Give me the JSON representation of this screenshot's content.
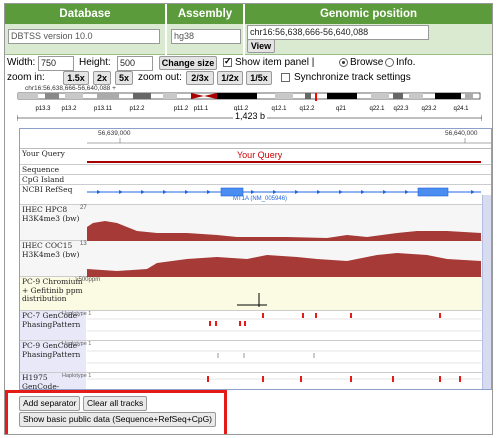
{
  "header": {
    "database_title": "Database",
    "assembly_title": "Assembly",
    "position_title": "Genomic position",
    "database_value": "DBTSS version 10.0",
    "assembly_value": "hg38",
    "position_value": "chr16:56,638,666-56,640,088",
    "view_label": "View"
  },
  "controls": {
    "width_label": "Width:",
    "width_value": "750",
    "height_label": "Height:",
    "height_value": "500",
    "change_size_label": "Change size",
    "show_item_panel_label": "Show item panel |",
    "browse_label": "Browse",
    "info_label": "Info.",
    "zoom_in_label": "zoom in:",
    "zoom_in_options": [
      "1.5x",
      "2x",
      "5x"
    ],
    "zoom_out_label": "zoom out:",
    "zoom_out_options": [
      "2/3x",
      "1/2x",
      "1/5x"
    ],
    "sync_label": "Synchronize track settings"
  },
  "ideogram": {
    "locus_text": "chr16:56,638,666-56,640,088 +",
    "bands": [
      "p13.3",
      "p13.2",
      "p13.11",
      "p12.2",
      "p11.2",
      "p11.1",
      "q11.2",
      "q12.1",
      "q12.2",
      "q21",
      "q22.1",
      "q22.3",
      "q23.2",
      "q24.1"
    ],
    "scale_text": "1,423 b"
  },
  "ruler": {
    "left_tick": "56,639,000",
    "right_tick": "56,640,000"
  },
  "tracks": [
    {
      "label": "Your Query",
      "center_text": "Your Query"
    },
    {
      "label": "Sequence"
    },
    {
      "label": "CpG Island"
    },
    {
      "label": "NCBI RefSeq",
      "gene_label": "MT1A (NM_005946)"
    },
    {
      "label": "IHEC HPC8 H3K4me3 (bw)",
      "scale": "27"
    },
    {
      "label": "IHEC COC15 H3K4me3 (bw)",
      "scale": "13"
    },
    {
      "label": "PC-9 Chromium + Gefitinib ppm distribution",
      "scale": ">500ppm"
    },
    {
      "label": "PC-7 GenCode-PhasingPattern",
      "haplotype": "Haplotype 1"
    },
    {
      "label": "PC-9 GenCode-PhasingPattern",
      "haplotype": "Haplotype 1"
    },
    {
      "label": "H1975 GenCode-PhasingPattern",
      "haplotype": "Haplotype 1"
    }
  ],
  "buttons": {
    "add_separator": "Add separator",
    "clear_all": "Clear all tracks",
    "show_basic": "Show basic public data (Sequence+RefSeq+CpG)"
  },
  "colors": {
    "header_green": "#5c9b3c",
    "signal_red": "#a53a36",
    "gene_blue": "#2266dd",
    "highlight_red": "#e41b17"
  }
}
